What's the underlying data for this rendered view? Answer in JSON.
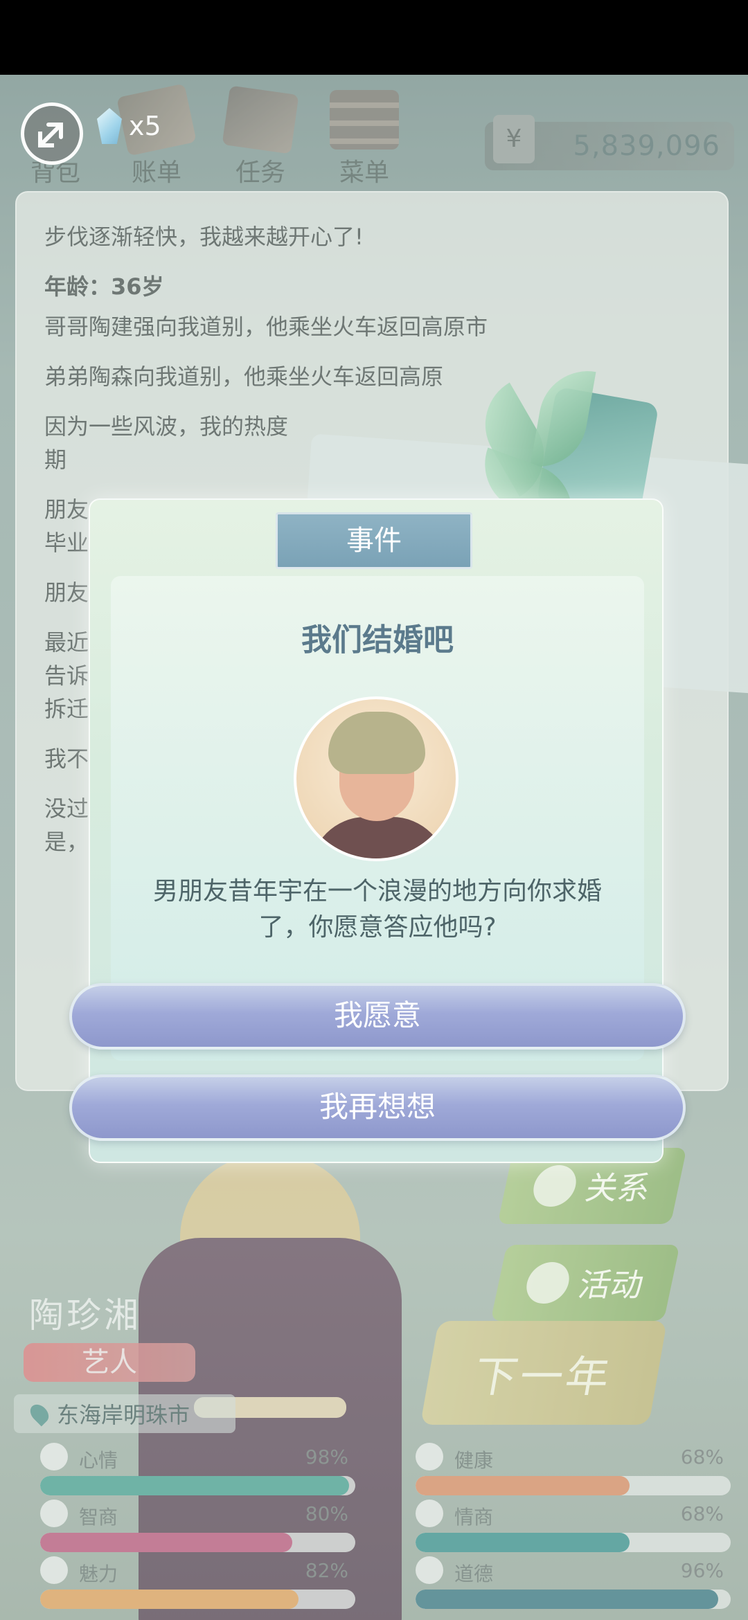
{
  "top_nav": {
    "items": [
      {
        "label": "背包"
      },
      {
        "label": "账单"
      },
      {
        "label": "任务"
      },
      {
        "label": "菜单"
      }
    ],
    "gem_count": "x5",
    "currency_symbol": "¥",
    "money": "5,839,096"
  },
  "diary": {
    "lines": [
      "步伐逐渐轻快，我越来越开心了!",
      "年龄：36岁",
      "哥哥陶建强向我道别，他乘坐火车返回高原市",
      "弟弟陶森向我道别，他乘坐火车返回高原",
      "因为一些风波，我的热度",
      "期",
      "朋友",
      "毕业",
      "朋友",
      "最近",
      "告诉",
      "拆迁",
      "我不",
      "没过",
      "是，"
    ]
  },
  "side_buttons": {
    "relation": "关系",
    "activity": "活动",
    "next_year": "下一年"
  },
  "character": {
    "name": "陶珍湘",
    "job": "艺人",
    "location": "东海岸明珠市"
  },
  "stats": [
    {
      "label": "心情",
      "value": "98%",
      "percent": 98,
      "color": "#3d9a8a"
    },
    {
      "label": "健康",
      "value": "68%",
      "percent": 68,
      "color": "#d1865a"
    },
    {
      "label": "智商",
      "value": "80%",
      "percent": 80,
      "color": "#b24f73"
    },
    {
      "label": "情商",
      "value": "68%",
      "percent": 68,
      "color": "#2e8a86"
    },
    {
      "label": "魅力",
      "value": "82%",
      "percent": 82,
      "color": "#d99a52"
    },
    {
      "label": "道德",
      "value": "96%",
      "percent": 96,
      "color": "#2f6f7a"
    }
  ],
  "event": {
    "tab": "事件",
    "title": "我们结婚吧",
    "text": "男朋友昔年宇在一个浪漫的地方向你求婚了，你愿意答应他吗?",
    "accept": "我愿意",
    "decline": "我再想想"
  }
}
